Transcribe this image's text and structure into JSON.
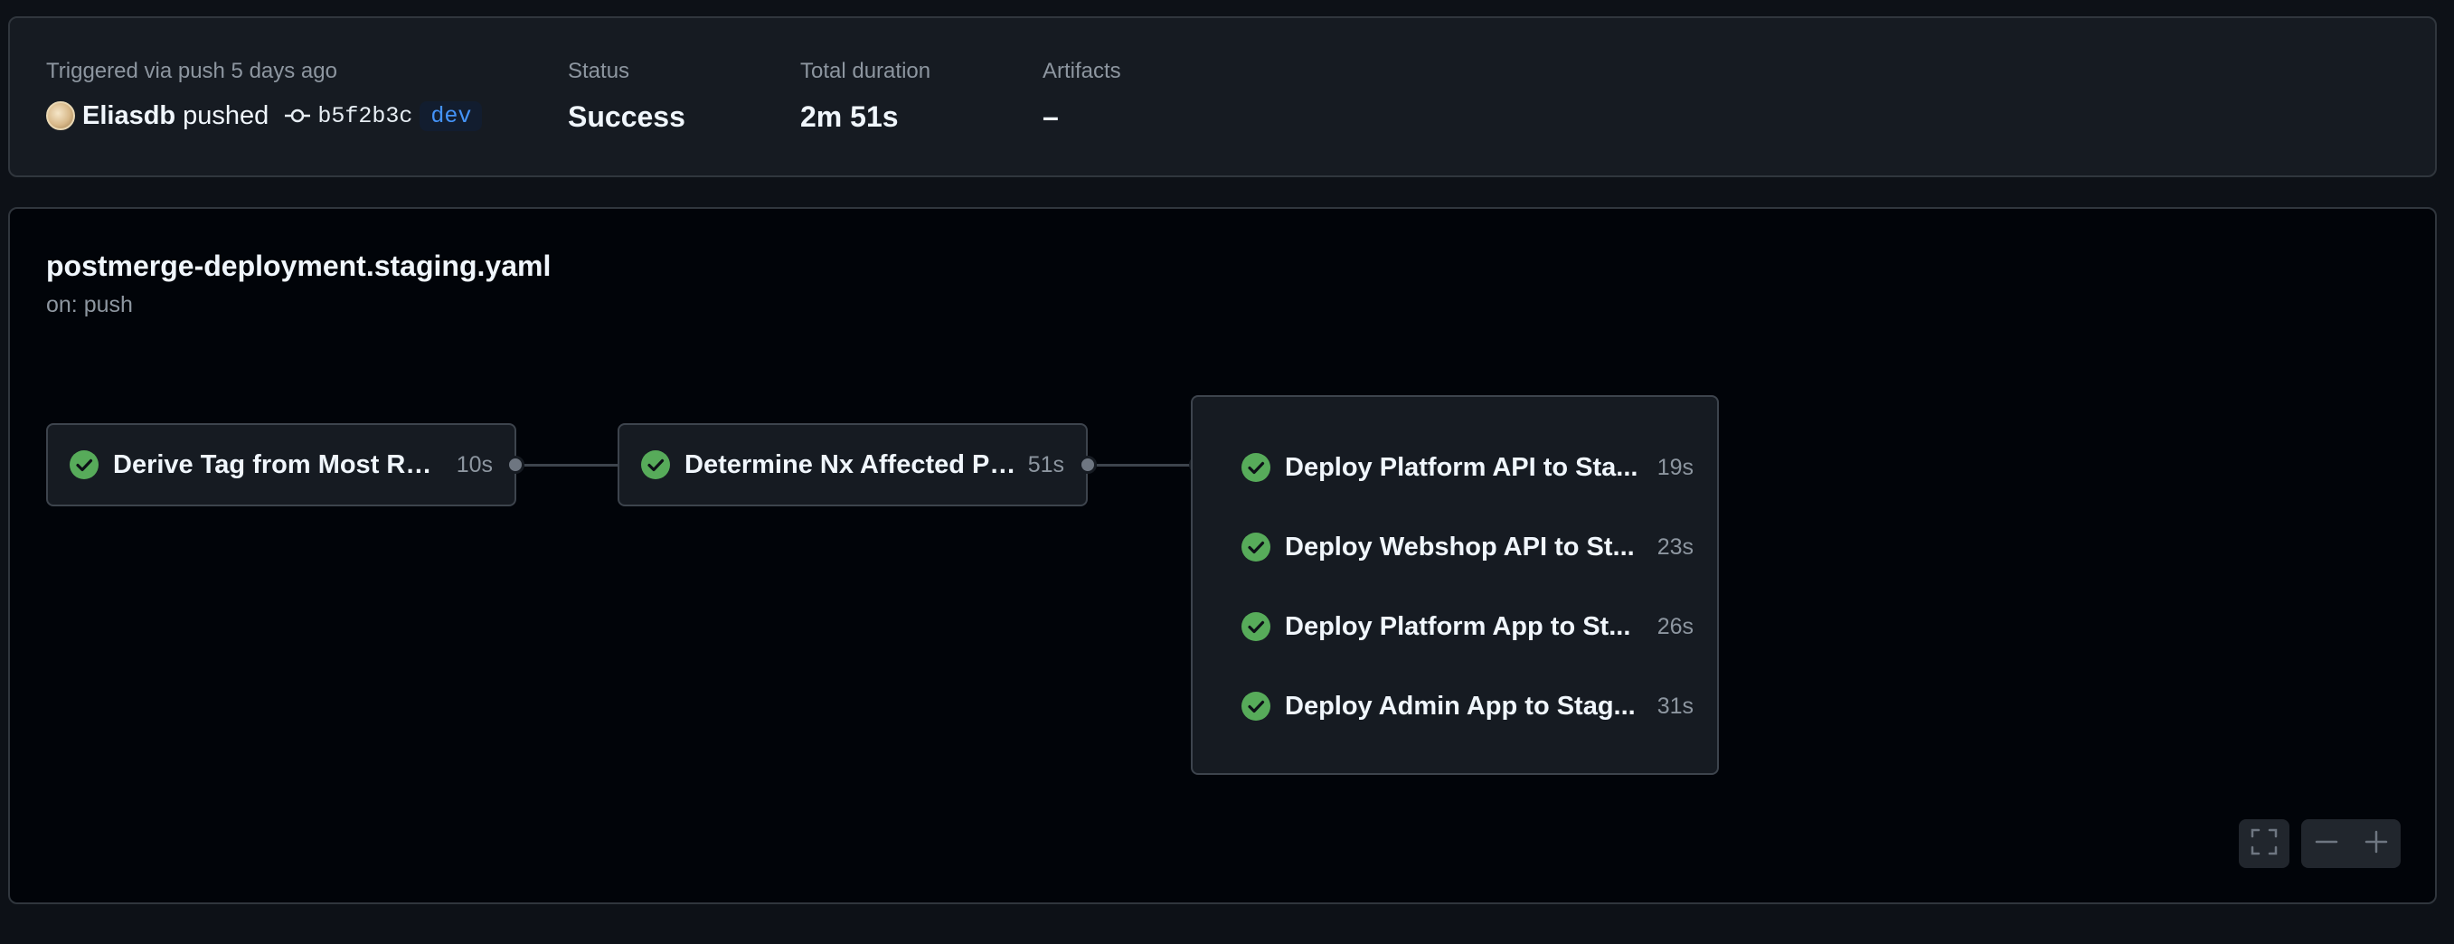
{
  "summary": {
    "trigger_label": "Triggered via push 5 days ago",
    "user": "Eliasdb",
    "action": "pushed",
    "commit_sha": "b5f2b3c",
    "branch": "dev",
    "status_label": "Status",
    "status_value": "Success",
    "duration_label": "Total duration",
    "duration_value": "2m 51s",
    "artifacts_label": "Artifacts",
    "artifacts_value": "–"
  },
  "workflow": {
    "title": "postmerge-deployment.staging.yaml",
    "trigger": "on: push",
    "jobs": [
      {
        "name": "Derive Tag from Most Rec...",
        "duration": "10s",
        "status": "success"
      },
      {
        "name": "Determine Nx Affected Pr...",
        "duration": "51s",
        "status": "success"
      }
    ],
    "deploy_group": [
      {
        "name": "Deploy Platform API to Sta...",
        "duration": "19s",
        "status": "success"
      },
      {
        "name": "Deploy Webshop API to St...",
        "duration": "23s",
        "status": "success"
      },
      {
        "name": "Deploy Platform App to St...",
        "duration": "26s",
        "status": "success"
      },
      {
        "name": "Deploy Admin App to Stag...",
        "duration": "31s",
        "status": "success"
      }
    ]
  },
  "icons": {
    "success": "check-circle-icon",
    "commit": "git-commit-icon",
    "fullscreen": "fullscreen-icon",
    "zoom_out": "minus-icon",
    "zoom_in": "plus-icon"
  },
  "colors": {
    "success": "#57ab5a",
    "accent_blue": "#4493f8",
    "panel": "#161b22",
    "canvas": "#010409"
  }
}
